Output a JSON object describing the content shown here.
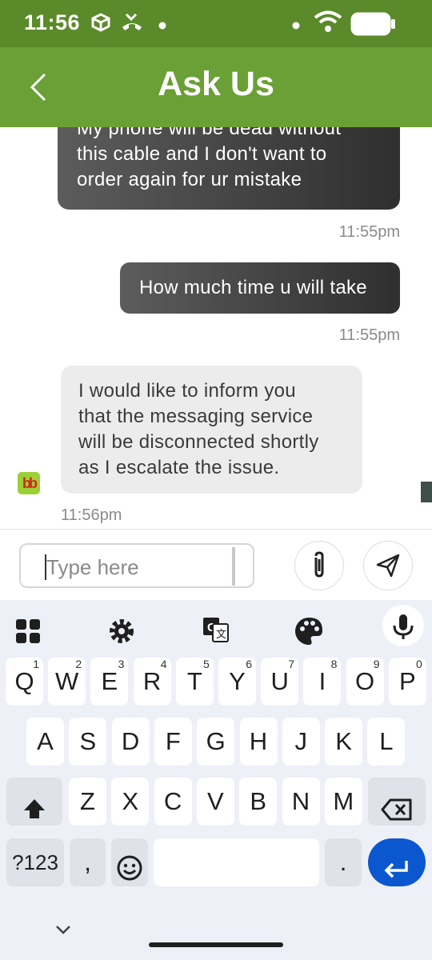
{
  "status_bar": {
    "time": "11:56"
  },
  "app_bar": {
    "title": "Ask Us"
  },
  "messages": [
    {
      "from": "user",
      "lines": [
        "My phone will be dead without",
        "this cable and I don't want to",
        "order again for ur mistake"
      ],
      "time": "11:55pm"
    },
    {
      "from": "user",
      "lines": [
        "How much time u will take"
      ],
      "time": "11:55pm"
    },
    {
      "from": "agent",
      "avatar": "bb",
      "lines": [
        "I would like to inform you",
        "that the messaging service",
        "will be disconnected shortly",
        "as I escalate the issue."
      ],
      "time": "11:56pm"
    }
  ],
  "composer": {
    "placeholder": "Type here"
  },
  "keyboard": {
    "row1": [
      {
        "key": "Q",
        "hint": "1"
      },
      {
        "key": "W",
        "hint": "2"
      },
      {
        "key": "E",
        "hint": "3"
      },
      {
        "key": "R",
        "hint": "4"
      },
      {
        "key": "T",
        "hint": "5"
      },
      {
        "key": "Y",
        "hint": "6"
      },
      {
        "key": "U",
        "hint": "7"
      },
      {
        "key": "I",
        "hint": "8"
      },
      {
        "key": "O",
        "hint": "9"
      },
      {
        "key": "P",
        "hint": "0"
      }
    ],
    "row2": [
      "A",
      "S",
      "D",
      "F",
      "G",
      "H",
      "J",
      "K",
      "L"
    ],
    "row3": [
      "Z",
      "X",
      "C",
      "V",
      "B",
      "N",
      "M"
    ],
    "symbols_label": "?123",
    "comma": ",",
    "period": "."
  },
  "colors": {
    "status_bar": "#5a8a2a",
    "app_bar": "#6aa035",
    "enter_key": "#0b57d0"
  }
}
